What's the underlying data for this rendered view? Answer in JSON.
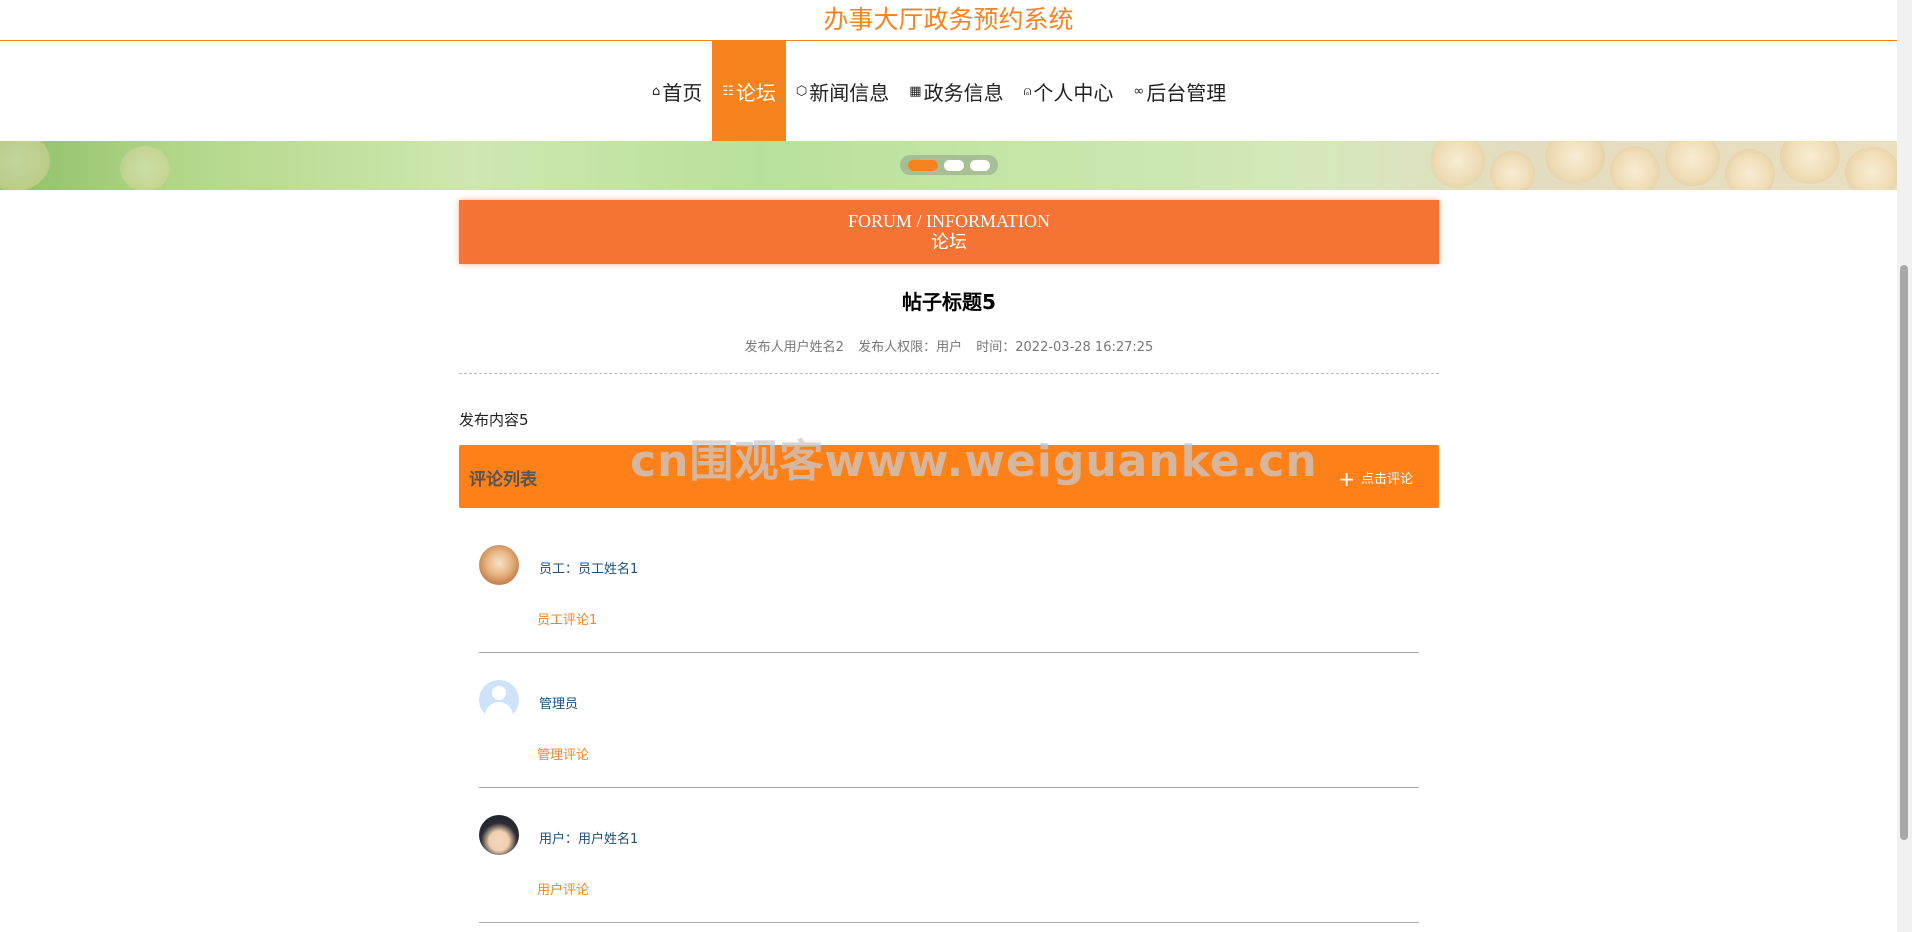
{
  "site_title": "办事大厅政务预约系统",
  "nav": [
    {
      "label": "首页",
      "icon": "home-icon",
      "glyph": "⌂",
      "active": false
    },
    {
      "label": "论坛",
      "icon": "forum-icon",
      "glyph": "☷",
      "active": true
    },
    {
      "label": "新闻信息",
      "icon": "cube-icon",
      "glyph": "⬡",
      "active": false
    },
    {
      "label": "政务信息",
      "icon": "gift-icon",
      "glyph": "▦",
      "active": false
    },
    {
      "label": "个人中心",
      "icon": "user-icon",
      "glyph": "⍝",
      "active": false
    },
    {
      "label": "后台管理",
      "icon": "link-icon",
      "glyph": "∞",
      "active": false
    }
  ],
  "carousel": {
    "slide_count": 3,
    "active_index": 0
  },
  "section": {
    "en": "FORUM / INFORMATION",
    "cn": "论坛"
  },
  "post": {
    "title": "帖子标题5",
    "author": "发布人用户姓名2",
    "role": "发布人权限：用户",
    "time": "时间：2022-03-28 16:27:25",
    "content": "发布内容5"
  },
  "comments_header": {
    "label": "评论列表",
    "add_label": "点击评论"
  },
  "watermark": "cn围观客www.weiguanke.cn",
  "comments": [
    {
      "name": "员工：员工姓名1",
      "text": "员工评论1",
      "avatar": "dog-avatar"
    },
    {
      "name": "管理员",
      "text": "管理评论",
      "avatar": "default-avatar"
    },
    {
      "name": "用户：用户姓名1",
      "text": "用户评论",
      "avatar": "anime-avatar"
    }
  ],
  "colors": {
    "accent": "#f7831f",
    "header_bar": "#f47335",
    "comment_bar": "#fd8019",
    "name_text": "#1f4e79"
  }
}
